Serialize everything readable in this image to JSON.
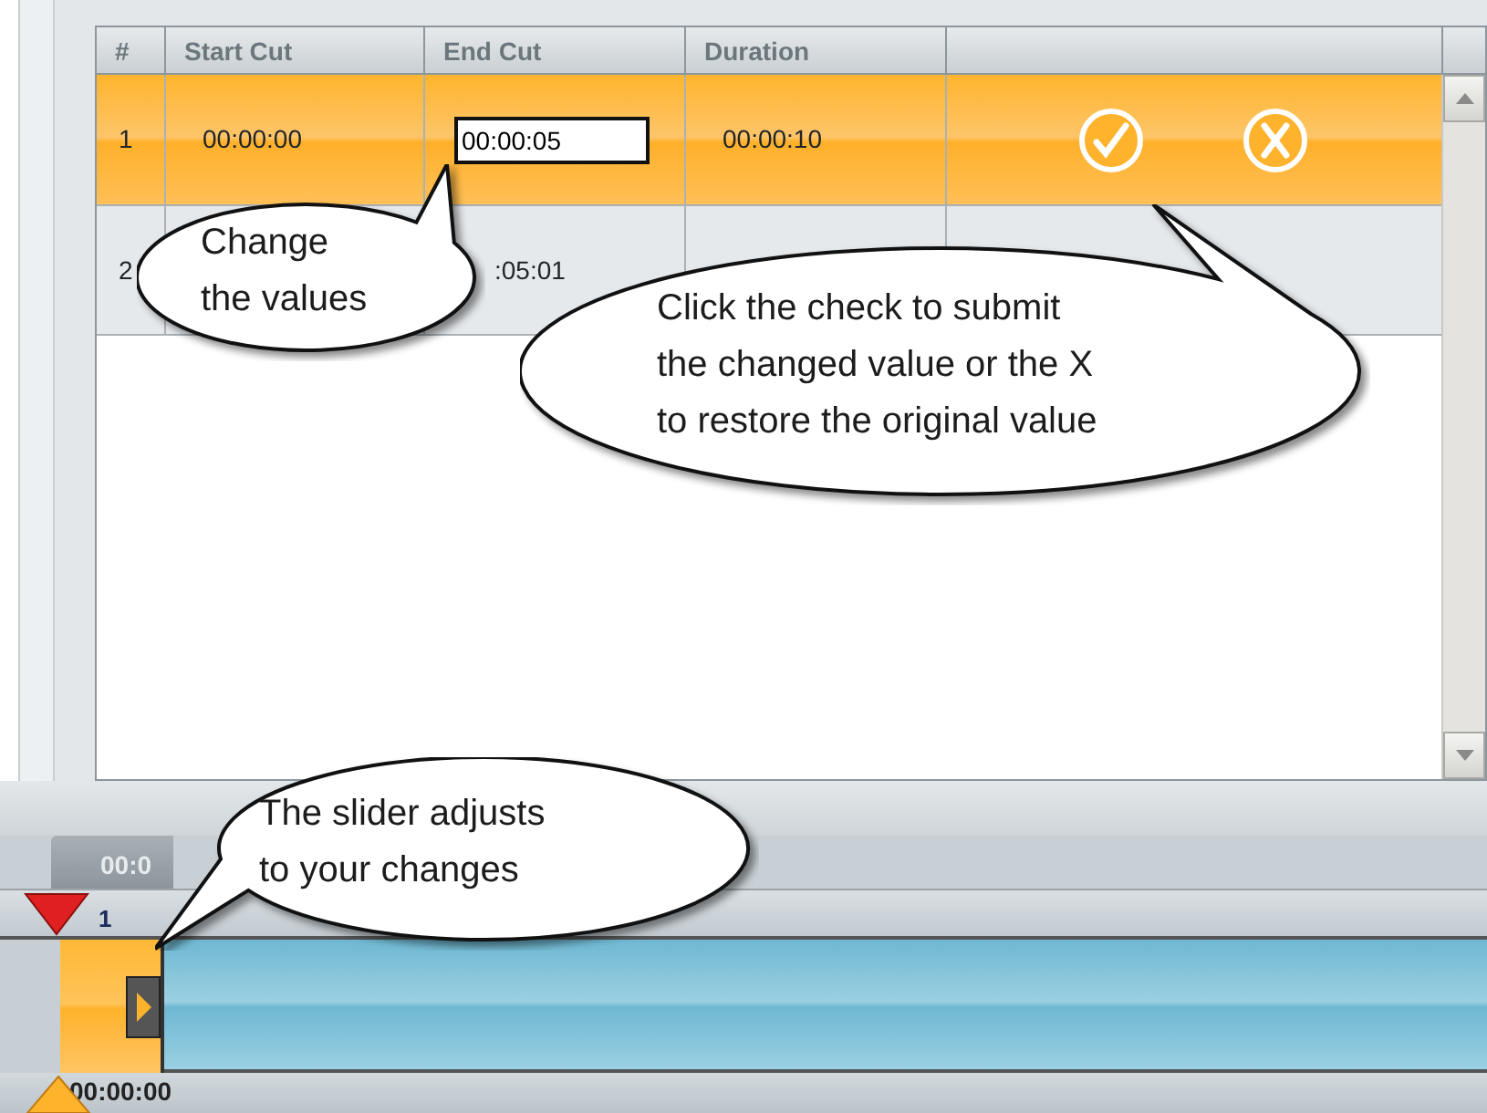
{
  "table": {
    "columns": [
      "#",
      "Start Cut",
      "End Cut",
      "Duration"
    ],
    "rows": [
      {
        "number": "1",
        "start_cut": "00:00:00",
        "end_cut": "00:00:05",
        "duration": "00:00:10",
        "selected": true,
        "editing": true
      },
      {
        "number": "2",
        "start_cut": "",
        "end_cut": ":05:01",
        "duration": "",
        "selected": false,
        "editing": false
      }
    ]
  },
  "timeline": {
    "tab": "00:0",
    "track": "1",
    "time": "00:00:00"
  },
  "callouts": [
    {
      "text": "Change\nthe values"
    },
    {
      "text": "Click the check to submit\nthe changed value or the X\nto restore the original value"
    },
    {
      "text": "The slider adjusts\nto your changes"
    }
  ]
}
